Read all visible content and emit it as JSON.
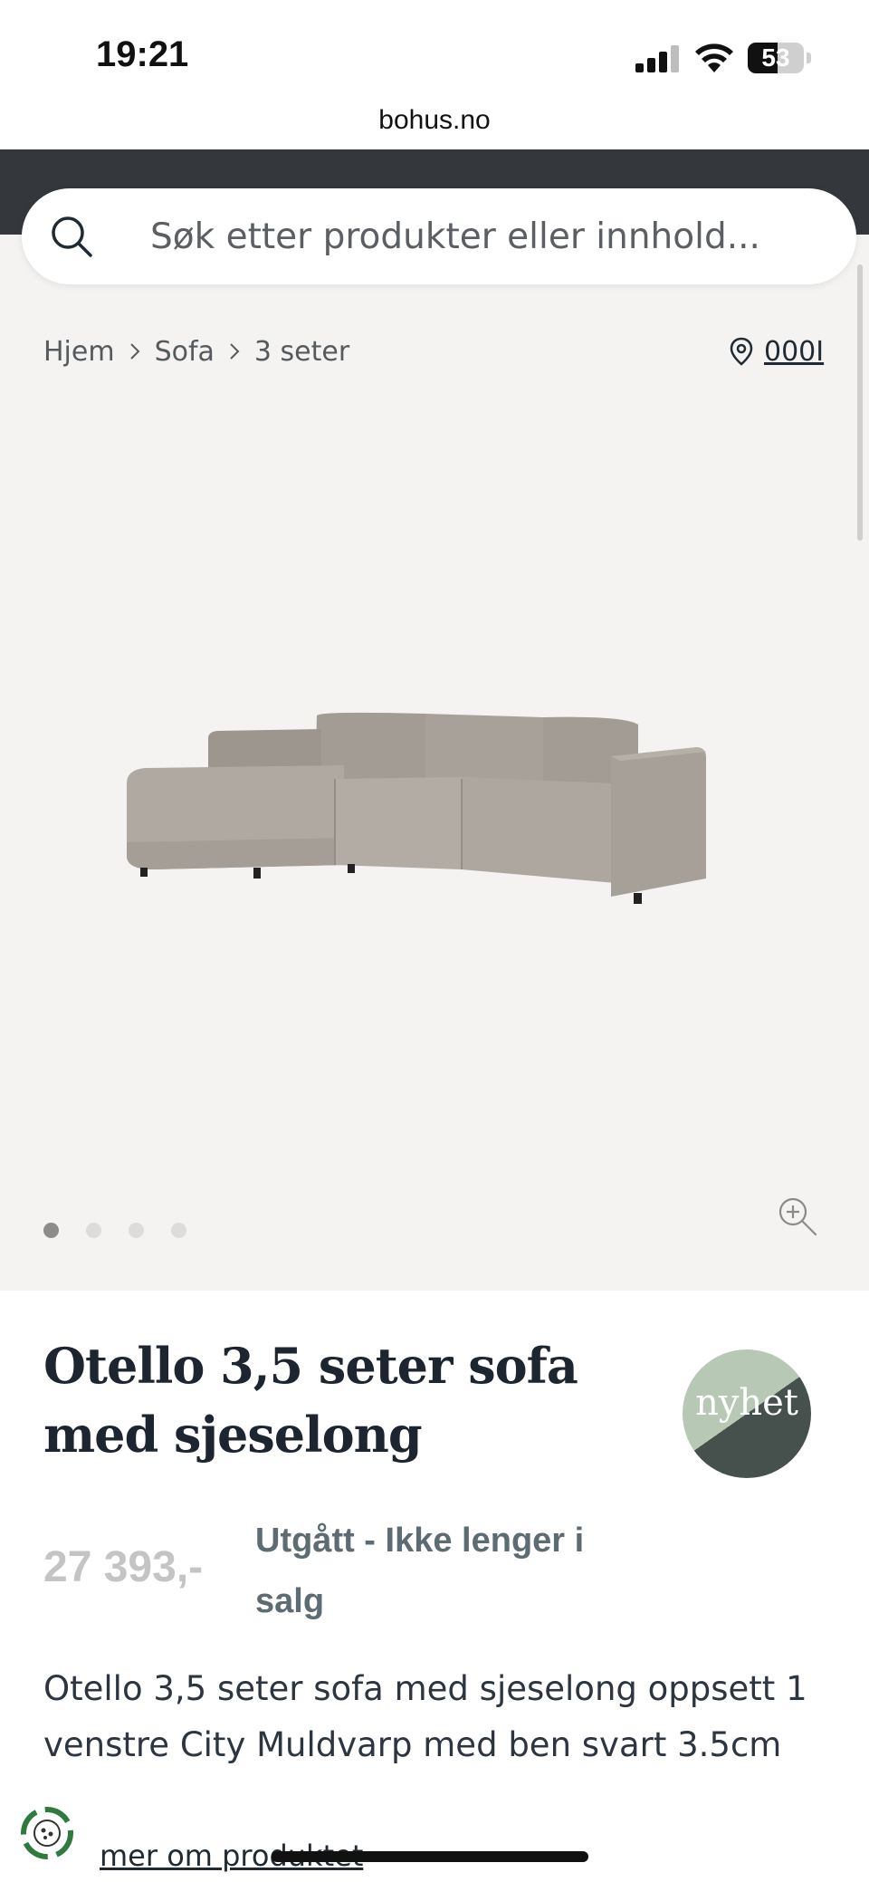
{
  "status_bar": {
    "time": "19:21",
    "battery": "53",
    "battery_level_percent": 53
  },
  "browser": {
    "url": "bohus.no"
  },
  "search": {
    "placeholder": "Søk etter produkter eller innhold..."
  },
  "breadcrumb": {
    "items": [
      "Hjem",
      "Sofa",
      "3 seter"
    ]
  },
  "store": {
    "label": "000I"
  },
  "gallery": {
    "image_count": 4,
    "active_index": 0,
    "zoom_icon": "zoom-in-icon"
  },
  "product": {
    "title": "Otello 3,5 seter sofa med sjeselong",
    "badge": "nyhet",
    "price": "27 393,-",
    "availability": "Utgått - Ikke lenger i salg",
    "description": "Otello 3,5 seter sofa med sjeselong oppsett 1 venstre City Muldvarp med ben svart 3.5cm",
    "more_link": "mer om produktet"
  },
  "colors": {
    "header_dark": "#34373b",
    "content_bg": "#f4f3f1",
    "badge_light": "#b7c8b5",
    "badge_dark": "#46504d",
    "price_gray": "#c4c4c4",
    "availability": "#5d6b73"
  }
}
